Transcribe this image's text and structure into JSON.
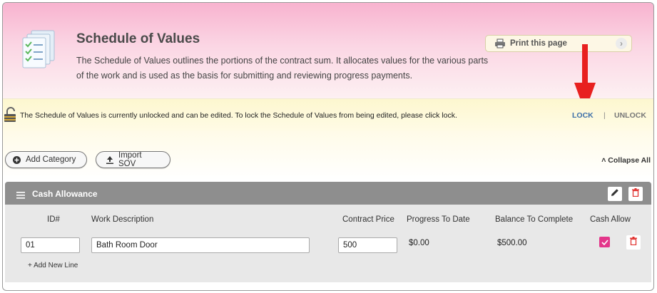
{
  "header": {
    "title": "Schedule of Values",
    "description": "The Schedule of Values outlines the portions of the contract sum. It allocates values for the various parts of the work and is used as the basis for submitting and reviewing progress payments.",
    "print_label": "Print this page"
  },
  "lock_bar": {
    "message": "The Schedule of Values is currently unlocked and can be edited. To lock the Schedule of Values from being edited, please click lock.",
    "lock_label": "LOCK",
    "separator": "|",
    "unlock_label": "UNLOCK"
  },
  "toolbar": {
    "add_category_label": "Add Category",
    "import_label": "Import SOV",
    "collapse_all_label": "Collapse All"
  },
  "category": {
    "name": "Cash Allowance",
    "columns": [
      "ID#",
      "Work Description",
      "Contract Price",
      "Progress To Date",
      "Balance To Complete",
      "Cash Allow"
    ],
    "rows": [
      {
        "id": "01",
        "description": "Bath Room Door",
        "contract_price": "500",
        "progress_to_date": "$0.00",
        "balance_to_complete": "$500.00",
        "cash_allow": true
      }
    ],
    "add_line_label": "+ Add New Line"
  },
  "colors": {
    "header_gradient_top": "#f8b3cf",
    "lockbar_bg": "#fdf7cf",
    "category_header": "#8e8e8e",
    "lock_link": "#3d6fa8",
    "checkbox_accent": "#e3368a",
    "delete_red": "#e0322f",
    "annotation_arrow": "#e8201f"
  },
  "icons": [
    "document-checklist-icon",
    "printer-icon",
    "chevron-right-icon",
    "padlock-open-icon",
    "plus-circle-icon",
    "upload-icon",
    "double-chevron-up-icon",
    "hamburger-menu-icon",
    "pencil-icon",
    "trash-icon",
    "checkmark-icon",
    "red-arrow-annotation"
  ]
}
